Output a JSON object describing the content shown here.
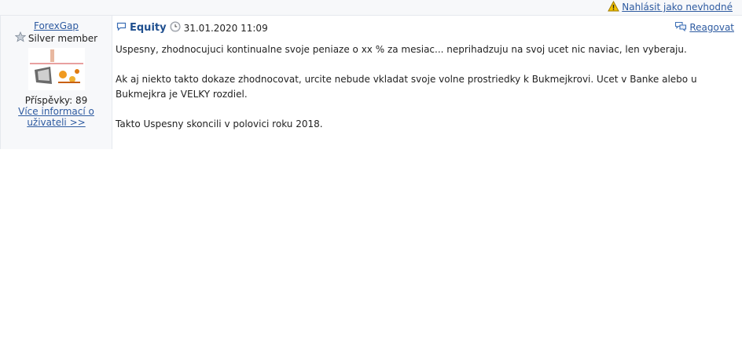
{
  "report_link": "Nahlásit jako nevhodné",
  "author": {
    "name": "ForexGap",
    "rank": "Silver member",
    "posts": "Příspěvky: 89",
    "more_info": "Více informací o uživateli >>"
  },
  "post": {
    "title": "Equity",
    "date": "31.01.2020 11:09",
    "reply": "Reagovat",
    "paragraphs": [
      "Uspesny, zhodnocujuci kontinualne svoje peniaze o xx % za mesiac... neprihadzuju na svoj ucet nic naviac, len vyberaju.",
      "Ak aj niekto takto dokaze zhodnocovat, urcite nebude vkladat svoje volne prostriedky k Bukmejkrovi. Ucet v Banke alebo u Bukmejkra je VELKY rozdiel.",
      "Takto Uspesny skoncili v polovici roku 2018."
    ]
  }
}
